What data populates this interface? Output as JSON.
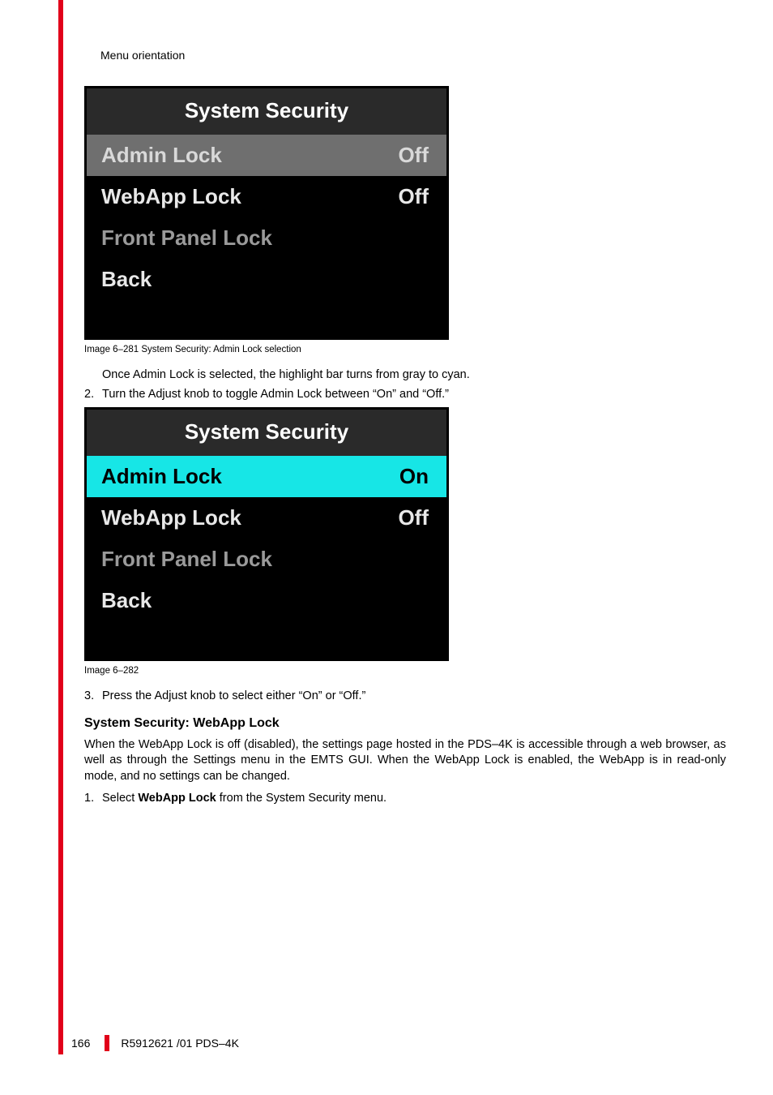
{
  "header": {
    "breadcrumb": "Menu orientation"
  },
  "panel1": {
    "title": "System Security",
    "rows": [
      {
        "label": "Admin Lock",
        "value": "Off"
      },
      {
        "label": "WebApp Lock",
        "value": "Off"
      },
      {
        "label": "Front Panel Lock",
        "value": ""
      },
      {
        "label": "Back",
        "value": ""
      }
    ]
  },
  "caption1": "Image 6–281  System Security: Admin Lock selection",
  "para1": "Once Admin Lock is selected, the highlight bar turns from gray to cyan.",
  "step2_num": "2.",
  "step2_text": "Turn the Adjust knob to toggle Admin Lock between “On” and “Off.”",
  "panel2": {
    "title": "System Security",
    "rows": [
      {
        "label": "Admin Lock",
        "value": "On"
      },
      {
        "label": "WebApp Lock",
        "value": "Off"
      },
      {
        "label": "Front Panel Lock",
        "value": ""
      },
      {
        "label": "Back",
        "value": ""
      }
    ]
  },
  "caption2": "Image 6–282",
  "step3_num": "3.",
  "step3_text": "Press the Adjust knob to select either “On” or “Off.”",
  "section_heading": "System Security: WebApp Lock",
  "section_para": "When the WebApp Lock is off (disabled), the settings page hosted in the PDS–4K is accessible through a web browser, as well as through the Settings menu in the EMTS GUI. When the WebApp Lock is enabled, the WebApp is in read-only mode, and no settings can be changed.",
  "stepW1_num": "1.",
  "stepW1_prefix": "Select ",
  "stepW1_bold": "WebApp Lock",
  "stepW1_suffix": " from the System Security menu.",
  "footer": {
    "page": "166",
    "doc": "R5912621 /01 PDS–4K"
  }
}
